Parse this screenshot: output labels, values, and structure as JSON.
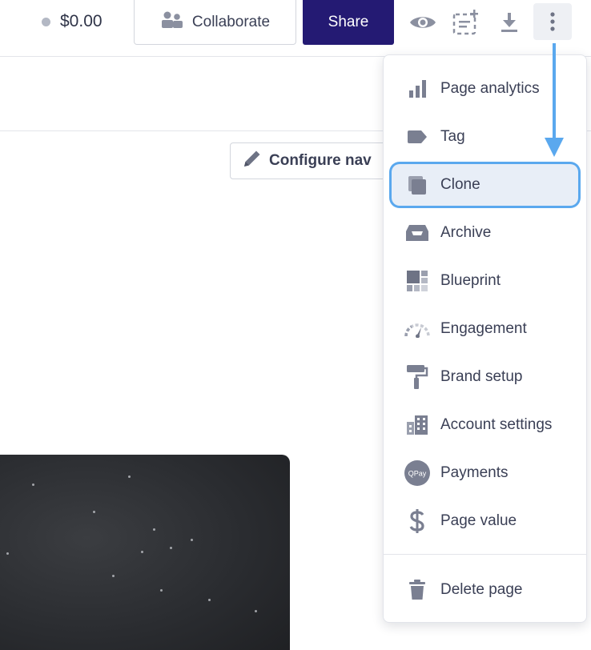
{
  "header": {
    "price": "$0.00",
    "collaborate_label": "Collaborate",
    "share_label": "Share",
    "icons": [
      "eye-icon",
      "add-section-icon",
      "download-icon",
      "more-vertical-icon"
    ]
  },
  "toolbar": {
    "configure_nav_label": "Configure nav"
  },
  "menu": {
    "items": [
      {
        "label": "Page analytics",
        "icon": "bar-chart-icon"
      },
      {
        "label": "Tag",
        "icon": "tag-icon"
      },
      {
        "label": "Clone",
        "icon": "clone-icon",
        "highlighted": true
      },
      {
        "label": "Archive",
        "icon": "archive-icon"
      },
      {
        "label": "Blueprint",
        "icon": "blueprint-icon"
      },
      {
        "label": "Engagement",
        "icon": "gauge-icon"
      },
      {
        "label": "Brand setup",
        "icon": "paint-roller-icon"
      },
      {
        "label": "Account settings",
        "icon": "building-icon"
      },
      {
        "label": "Payments",
        "icon": "qpay-icon",
        "icon_text": "QPay"
      },
      {
        "label": "Page value",
        "icon": "dollar-icon"
      },
      {
        "label": "Delete page",
        "icon": "trash-icon"
      }
    ]
  },
  "colors": {
    "share_bg": "#241a73",
    "highlight_ring": "#5aa8ee",
    "arrow": "#5aa8ee",
    "icon_gray": "#6e7385"
  }
}
